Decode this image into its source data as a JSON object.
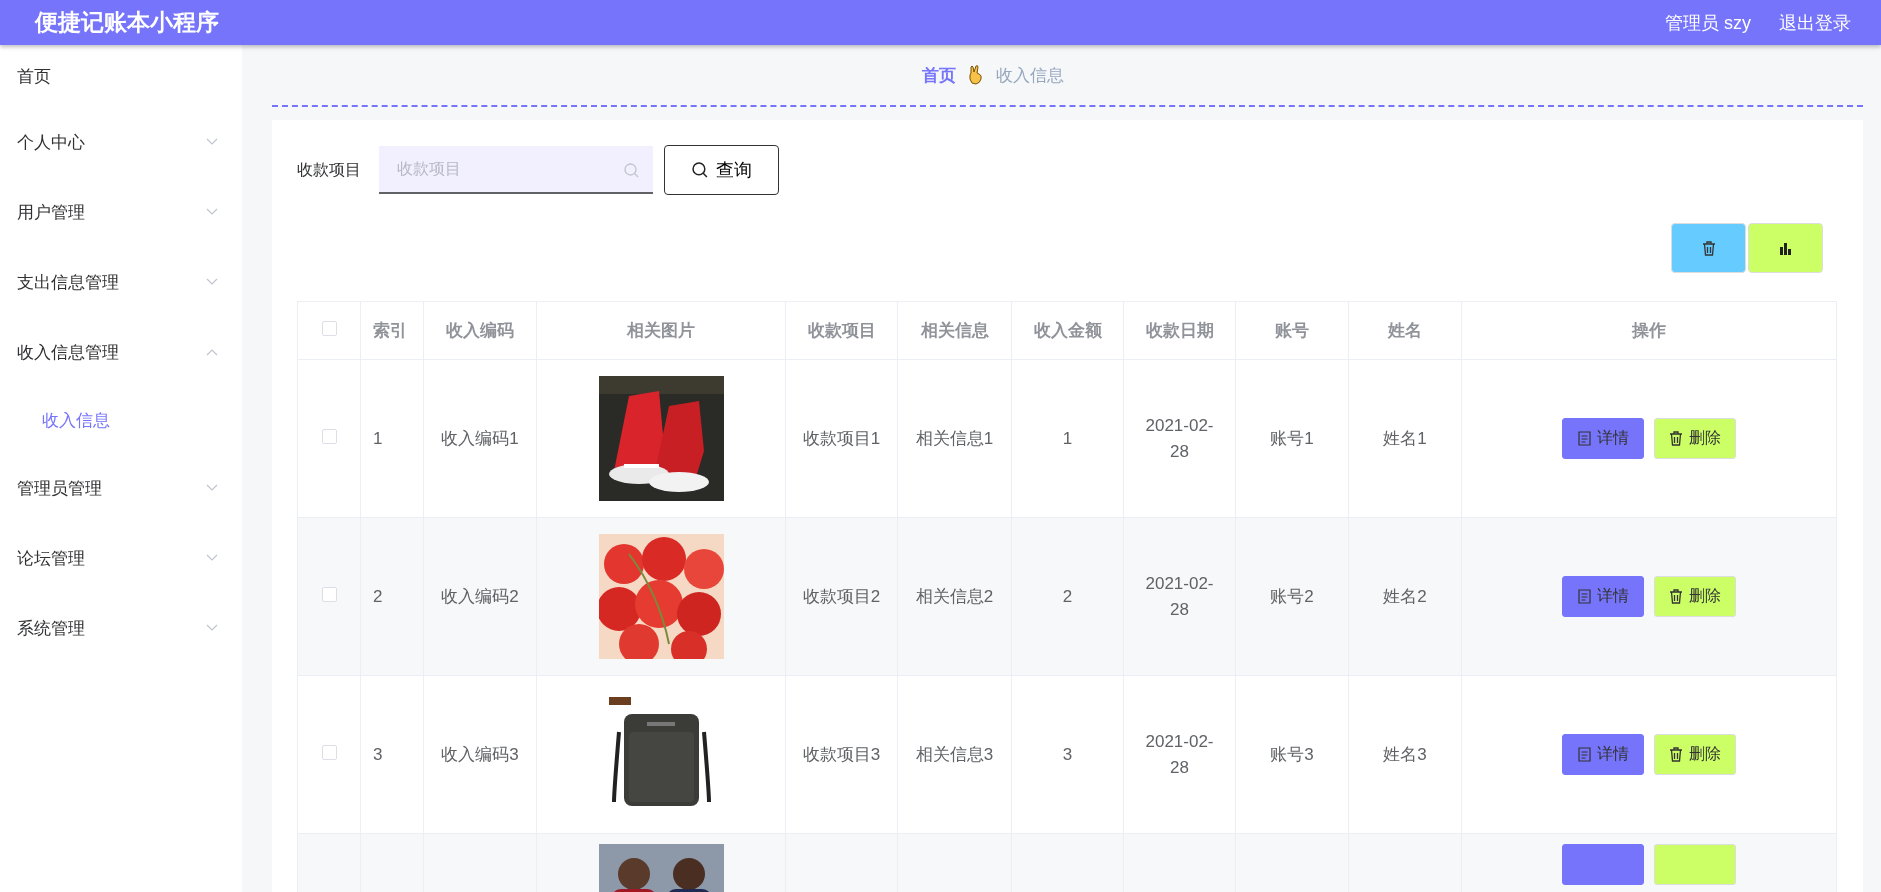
{
  "header": {
    "title": "便捷记账本小程序",
    "user": "管理员 szy",
    "logout": "退出登录"
  },
  "sidebar": {
    "items": [
      {
        "label": "首页"
      },
      {
        "label": "个人中心",
        "expandable": true,
        "expanded": false
      },
      {
        "label": "用户管理",
        "expandable": true,
        "expanded": false
      },
      {
        "label": "支出信息管理",
        "expandable": true,
        "expanded": false
      },
      {
        "label": "收入信息管理",
        "expandable": true,
        "expanded": true,
        "children": [
          {
            "label": "收入信息",
            "selected": true
          }
        ]
      },
      {
        "label": "管理员管理",
        "expandable": true,
        "expanded": false
      },
      {
        "label": "论坛管理",
        "expandable": true,
        "expanded": false
      },
      {
        "label": "系统管理",
        "expandable": true,
        "expanded": false
      }
    ]
  },
  "breadcrumb": [
    {
      "label": "首页",
      "current": false
    },
    {
      "label": "收入信息",
      "current": true
    }
  ],
  "search": {
    "label": "收款项目",
    "placeholder": "收款项目",
    "button": "查询"
  },
  "table": {
    "columns": [
      "索引",
      "收入编码",
      "相关图片",
      "收款项目",
      "相关信息",
      "收入金额",
      "收款日期",
      "账号",
      "姓名",
      "操作"
    ],
    "select_all": {
      "checked": false
    },
    "rows": [
      {
        "checked": false,
        "index": "1",
        "code": "收入编码1",
        "image": {
          "kind": "picture"
        },
        "item": "收款项目1",
        "info": "相关信息1",
        "amount": "1",
        "date": "2021-02-28",
        "account": "账号1",
        "name": "姓名1",
        "actions": [
          "详情",
          "删除"
        ]
      },
      {
        "checked": false,
        "index": "2",
        "code": "收入编码2",
        "image": {
          "kind": "picture"
        },
        "item": "收款项目2",
        "info": "相关信息2",
        "amount": "2",
        "date": "2021-02-28",
        "account": "账号2",
        "name": "姓名2",
        "actions": [
          "详情",
          "删除"
        ]
      },
      {
        "checked": false,
        "index": "3",
        "code": "收入编码3",
        "image": {
          "kind": "picture"
        },
        "item": "收款项目3",
        "info": "相关信息3",
        "amount": "3",
        "date": "2021-02-28",
        "account": "账号3",
        "name": "姓名3",
        "actions": [
          "详情",
          "删除"
        ]
      },
      {
        "image": {
          "kind": "picture"
        }
      }
    ]
  }
}
